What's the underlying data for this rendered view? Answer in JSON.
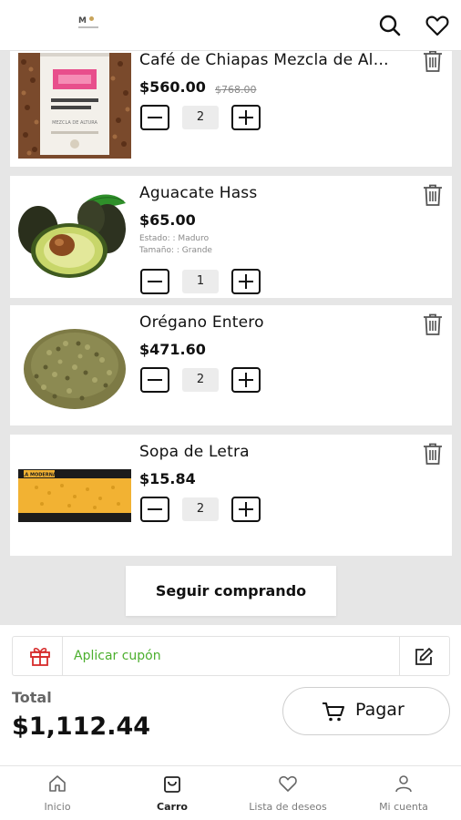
{
  "header": {
    "logo_text": "M",
    "search_icon": "search-icon",
    "wishlist_icon": "heart-icon"
  },
  "cart": {
    "items": [
      {
        "name": "Café de Chiapas Mezcla de Altura",
        "price": "$560.00",
        "old_price": "$768.00",
        "quantity": "2",
        "image_label": "MEZCLA DE ALTURA"
      },
      {
        "name": "Aguacate Hass",
        "price": "$65.00",
        "attr1": "Estado: : Maduro",
        "attr2": "Tamaño: : Grande",
        "quantity": "1"
      },
      {
        "name": "Orégano Entero",
        "price": "$471.60",
        "quantity": "2"
      },
      {
        "name": "Sopa de Letra",
        "price": "$15.84",
        "quantity": "2",
        "image_label": "LA MODERNA"
      }
    ],
    "continue_label": "Seguir comprando"
  },
  "summary": {
    "coupon_label": "Aplicar cupón",
    "total_label": "Total",
    "total_amount": "$1,112.44",
    "pay_label": "Pagar"
  },
  "nav": {
    "items": [
      {
        "label": "Inicio",
        "icon": "home-icon"
      },
      {
        "label": "Carro",
        "icon": "bag-icon",
        "active": true
      },
      {
        "label": "Lista de deseos",
        "icon": "heart-icon"
      },
      {
        "label": "Mi cuenta",
        "icon": "user-icon"
      }
    ]
  },
  "colors": {
    "accent_green": "#4caf2e",
    "gift_red": "#d62b2b",
    "background": "#e6e6e6"
  }
}
